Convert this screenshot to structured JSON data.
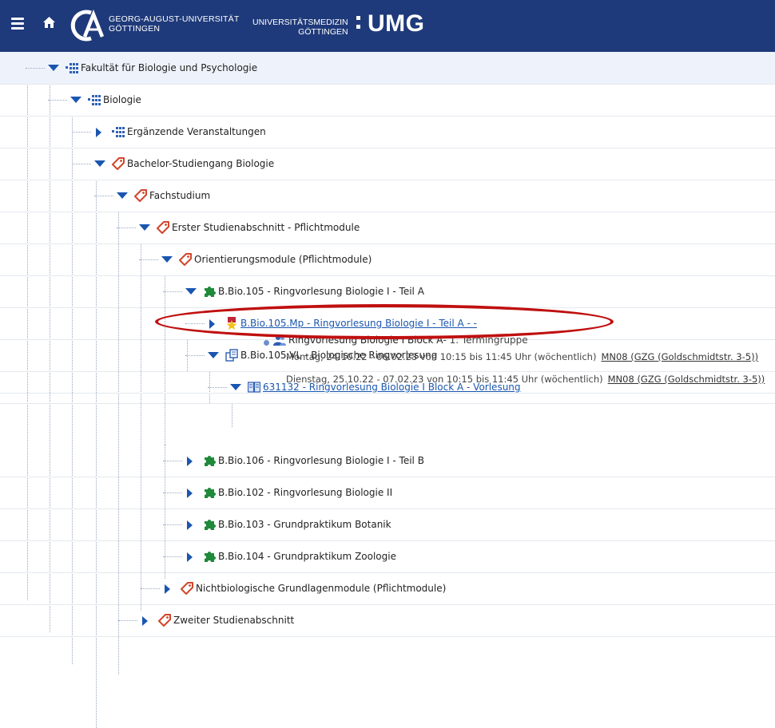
{
  "header": {
    "university_line1": "GEORG-AUGUST-UNIVERSITÄT",
    "university_line2": "GÖTTINGEN",
    "umg_line1": "UNIVERSITÄTSMEDIZIN",
    "umg_line2": "GÖTTINGEN",
    "umg_brand": "UMG",
    "background_color": "#1f3a7a"
  },
  "tree": [
    {
      "label": "Fakultät für Biologie und Psychologie",
      "icon": "faculty-dots-icon",
      "expanded": true
    },
    {
      "label": "Biologie",
      "icon": "faculty-dots-icon",
      "expanded": true
    },
    {
      "label": "Ergänzende Veranstaltungen",
      "icon": "faculty-dots-icon",
      "expanded": false
    },
    {
      "label": "Bachelor-Studiengang Biologie",
      "icon": "tag-icon",
      "expanded": true
    },
    {
      "label": "Fachstudium",
      "icon": "tag-icon",
      "expanded": true
    },
    {
      "label": "Erster Studienabschnitt - Pflichtmodule",
      "icon": "tag-icon",
      "expanded": true
    },
    {
      "label": "Orientierungsmodule (Pflichtmodule)",
      "icon": "tag-icon",
      "expanded": true
    },
    {
      "label": "B.Bio.105 - Ringvorlesung Biologie I - Teil A",
      "icon": "puzzle-icon",
      "expanded": true
    },
    {
      "label": "B.Bio.105.Mp - Ringvorlesung Biologie I - Teil A - -",
      "icon": "exam-badge-icon",
      "expanded": false,
      "link": true
    },
    {
      "label": "B.Bio.105.VL - Biologische Ringvorlesung",
      "icon": "courses-icon",
      "expanded": true
    },
    {
      "label": "631132 - Ringvorlesung Biologie I Block A - Vorlesung",
      "icon": "lecture-book-icon",
      "expanded": true,
      "link": true
    },
    {
      "label": "B.Bio.106 - Ringvorlesung Biologie I - Teil B",
      "icon": "puzzle-icon",
      "expanded": false
    },
    {
      "label": "B.Bio.102 - Ringvorlesung Biologie II",
      "icon": "puzzle-icon",
      "expanded": false
    },
    {
      "label": "B.Bio.103 - Grundpraktikum Botanik",
      "icon": "puzzle-icon",
      "expanded": false
    },
    {
      "label": "B.Bio.104 - Grundpraktikum Zoologie",
      "icon": "puzzle-icon",
      "expanded": false
    },
    {
      "label": "Nichtbiologische Grundlagenmodule (Pflichtmodule)",
      "icon": "tag-icon",
      "expanded": false
    },
    {
      "label": "Zweiter Studienabschnitt",
      "icon": "tag-icon",
      "expanded": false
    }
  ],
  "event": {
    "title": "Ringvorlesung Biologie I Block A",
    "group": " - 1. Termingruppe",
    "schedule": [
      {
        "text": "Montag, 24.10.22 - 06.02.23 von 10:15 bis 11:45 Uhr (wöchentlich)",
        "room": "MN08 (GZG (Goldschmidtstr. 3-5))"
      },
      {
        "text": "Dienstag, 25.10.22 - 07.02.23 von 10:15 bis 11:45 Uhr (wöchentlich)",
        "room": "MN08 (GZG (Goldschmidtstr. 3-5))"
      }
    ]
  },
  "colors": {
    "toggle": "#1a56b0",
    "tag": "#d2452a",
    "puzzle": "#1f8a3a",
    "link": "#1a56b0",
    "highlight": "#c00f0f"
  }
}
